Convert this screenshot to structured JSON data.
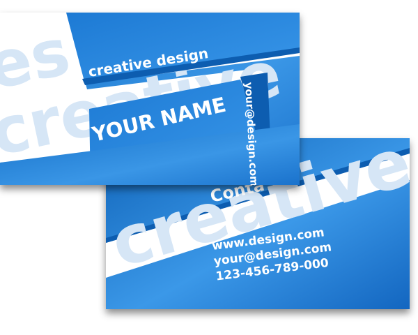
{
  "colors": {
    "card_blue": "#1a78d2",
    "card_blue_light": "#3b98e8",
    "card_blue_dark": "#0d5db0",
    "band_white": "#ffffff",
    "watermark": "#d6e6f6",
    "text_white": "#ffffff"
  },
  "front_card": {
    "watermark_top": "es",
    "watermark_bottom": "creative",
    "tagline": "creative design",
    "name": "YOUR NAME",
    "email_vertical": "your@design.com"
  },
  "back_card": {
    "watermark": "creative",
    "heading_partial": "Conta",
    "website": "www.design.com",
    "email": "your@design.com",
    "phone": "123-456-789-000"
  }
}
